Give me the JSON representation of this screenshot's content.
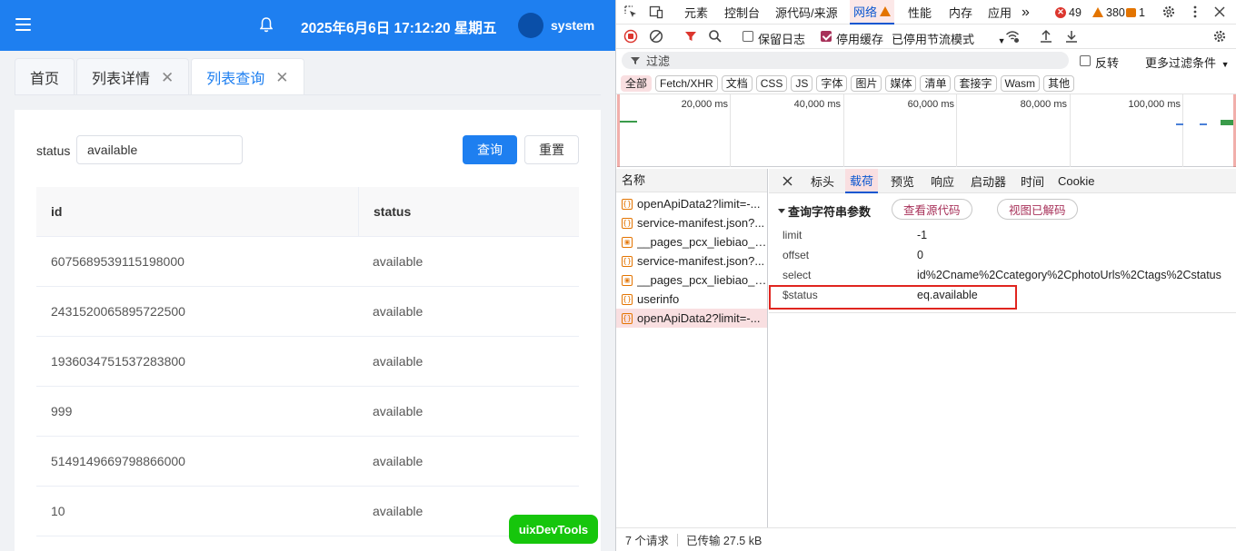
{
  "app": {
    "clock": "2025年6月6日 17:12:20 星期五",
    "username": "system",
    "tabs": [
      {
        "label": "首页",
        "closable": false,
        "active": false
      },
      {
        "label": "列表详情",
        "closable": true,
        "active": false
      },
      {
        "label": "列表查询",
        "closable": true,
        "active": true
      }
    ],
    "form": {
      "status_label": "status",
      "status_value": "available",
      "query_label": "查询",
      "reset_label": "重置"
    },
    "table": {
      "columns": [
        "id",
        "status"
      ],
      "rows": [
        {
          "id": "6075689539115198000",
          "status": "available"
        },
        {
          "id": "2431520065895722500",
          "status": "available"
        },
        {
          "id": "1936034751537283800",
          "status": "available"
        },
        {
          "id": "999",
          "status": "available"
        },
        {
          "id": "5149149669798866000",
          "status": "available"
        },
        {
          "id": "10",
          "status": "available"
        }
      ]
    },
    "uix_badge": "uixDevTools",
    "colors": {
      "primary": "#1e7ff0",
      "badge": "#16c60c"
    }
  },
  "devtools": {
    "main_tabs": [
      "元素",
      "控制台",
      "源代码/来源",
      "网络",
      "性能",
      "内存",
      "应用"
    ],
    "more_tabs": "»",
    "errors": "49",
    "warnings": "380",
    "issues": "1",
    "toolbar": {
      "preserve_log": "保留日志",
      "disable_cache": "停用缓存",
      "throttle": "已停用节流模式"
    },
    "filter": {
      "placeholder": "过滤",
      "invert": "反转",
      "more_filters": "更多过滤条件"
    },
    "types": [
      "全部",
      "Fetch/XHR",
      "文档",
      "CSS",
      "JS",
      "字体",
      "图片",
      "媒体",
      "清单",
      "套接字",
      "Wasm",
      "其他"
    ],
    "overview_ticks": [
      "20,000 ms",
      "40,000 ms",
      "60,000 ms",
      "80,000 ms",
      "100,000 ms"
    ],
    "name_header": "名称",
    "requests": [
      {
        "name": "openApiData2?limit=-...",
        "icon": "xhr-icon"
      },
      {
        "name": "service-manifest.json?...",
        "icon": "xhr-icon"
      },
      {
        "name": "__pages_pcx_liebiao_c...",
        "icon": "document-icon"
      },
      {
        "name": "service-manifest.json?...",
        "icon": "xhr-icon"
      },
      {
        "name": "__pages_pcx_liebiao_c...",
        "icon": "document-icon"
      },
      {
        "name": "userinfo",
        "icon": "xhr-icon"
      },
      {
        "name": "openApiData2?limit=-...",
        "icon": "xhr-icon"
      }
    ],
    "footer": {
      "requests": "7 个请求",
      "transferred": "已传输 27.5 kB"
    },
    "detail_tabs": [
      "标头",
      "载荷",
      "预览",
      "响应",
      "启动器",
      "时间",
      "Cookie"
    ],
    "payload": {
      "section_title": "查询字符串参数",
      "view_source": "查看源代码",
      "view_decoded": "视图已解码",
      "params": [
        {
          "key": "limit",
          "value": "-1"
        },
        {
          "key": "offset",
          "value": "0"
        },
        {
          "key": "select",
          "value": "id%2Cname%2Ccategory%2CphotoUrls%2Ctags%2Cstatus"
        },
        {
          "key": "$status",
          "value": "eq.available"
        }
      ]
    },
    "colors": {
      "accent": "#0b57d0",
      "highlight_box": "#e0251f",
      "selected_bg": "#f9dfe1"
    }
  }
}
